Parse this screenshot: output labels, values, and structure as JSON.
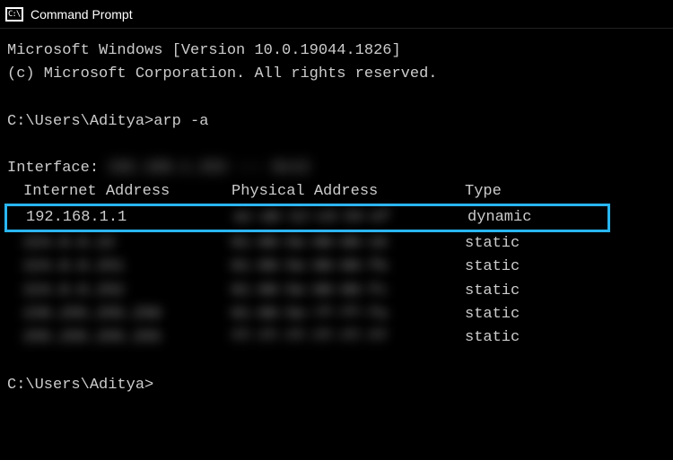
{
  "window": {
    "title": "Command Prompt",
    "icon_glyph": "C:\\"
  },
  "terminal": {
    "banner_line1": "Microsoft Windows [Version 10.0.19044.1826]",
    "banner_line2": "(c) Microsoft Corporation. All rights reserved.",
    "prompt_path": "C:\\Users\\Aditya>",
    "command": "arp -a",
    "interface_label": "Interface:",
    "interface_value_blurred": "192.168.1.253  ---  0x13",
    "headers": {
      "ip": "Internet Address",
      "phys": "Physical Address",
      "type": "Type"
    },
    "rows": [
      {
        "ip": "192.168.1.1",
        "phys_blurred": "ac-ab-12-cd-34-ef",
        "type": "dynamic",
        "highlighted": true
      },
      {
        "ip_blurred": "224.0.0.22",
        "phys_blurred": "01-00-5e-00-00-16",
        "type": "static"
      },
      {
        "ip_blurred": "224.0.0.251",
        "phys_blurred": "01-00-5e-00-00-fb",
        "type": "static"
      },
      {
        "ip_blurred": "224.0.0.252",
        "phys_blurred": "01-00-5e-00-00-fc",
        "type": "static"
      },
      {
        "ip_blurred": "239.255.255.250",
        "phys_blurred": "01-00-5e-7f-ff-fa",
        "type": "static"
      },
      {
        "ip_blurred": "255.255.255.255",
        "phys_blurred": "ff-ff-ff-ff-ff-ff",
        "type": "static"
      }
    ],
    "final_prompt": "C:\\Users\\Aditya>"
  }
}
